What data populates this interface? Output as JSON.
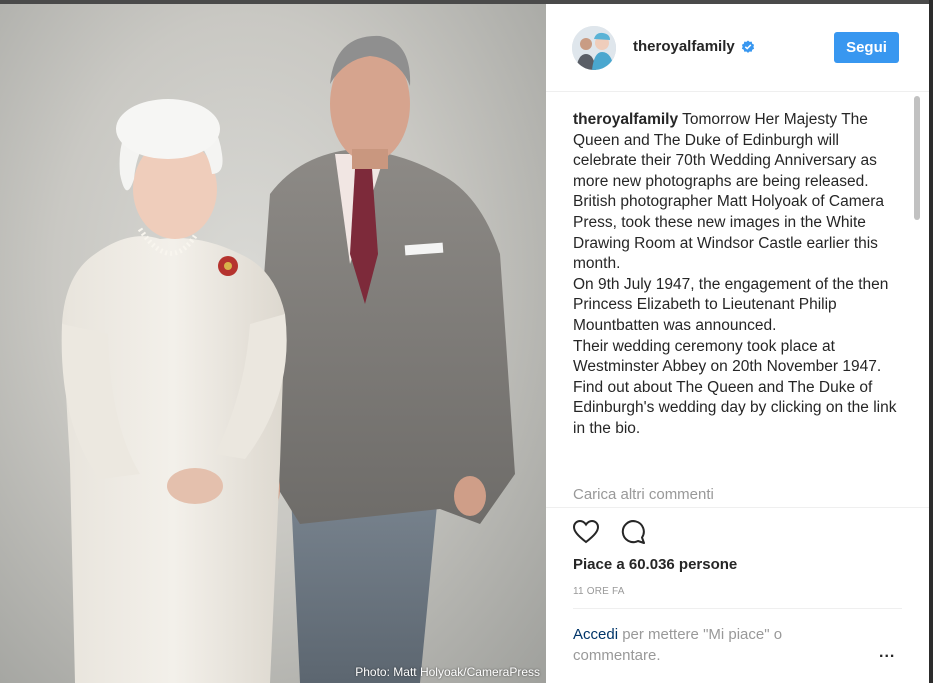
{
  "photo": {
    "credit": "Photo: Matt Holyoak/CameraPress"
  },
  "header": {
    "username": "theroyalfamily",
    "follow_label": "Segui"
  },
  "caption": {
    "username": "theroyalfamily",
    "paragraphs": [
      "Tomorrow Her Majesty The Queen and The Duke of Edinburgh will celebrate their 70th Wedding Anniversary as more new photographs are being released.",
      "British photographer Matt Holyoak of Camera Press, took these new images in the White Drawing Room at Windsor Castle earlier this month.",
      "On 9th July 1947, the engagement of the then Princess Elizabeth to Lieutenant Philip Mountbatten was announced.",
      "Their wedding ceremony took place at Westminster Abbey on 20th November 1947.",
      "Find out about The Queen and The Duke of Edinburgh's wedding day by clicking on the link in the bio."
    ],
    "load_more": "Carica altri commenti"
  },
  "actions": {
    "likes": "Piace a 60.036 persone",
    "time": "11 ORE FA"
  },
  "footer": {
    "login_link": "Accedi",
    "login_rest": " per mettere \"Mi piace\" o commentare.",
    "more": "..."
  },
  "icons": {
    "like": "heart-icon",
    "comment": "comment-icon",
    "verified": "verified-badge-icon"
  },
  "colors": {
    "accent": "#3897f0",
    "text": "#262626",
    "muted": "#999999",
    "link": "#003569"
  }
}
